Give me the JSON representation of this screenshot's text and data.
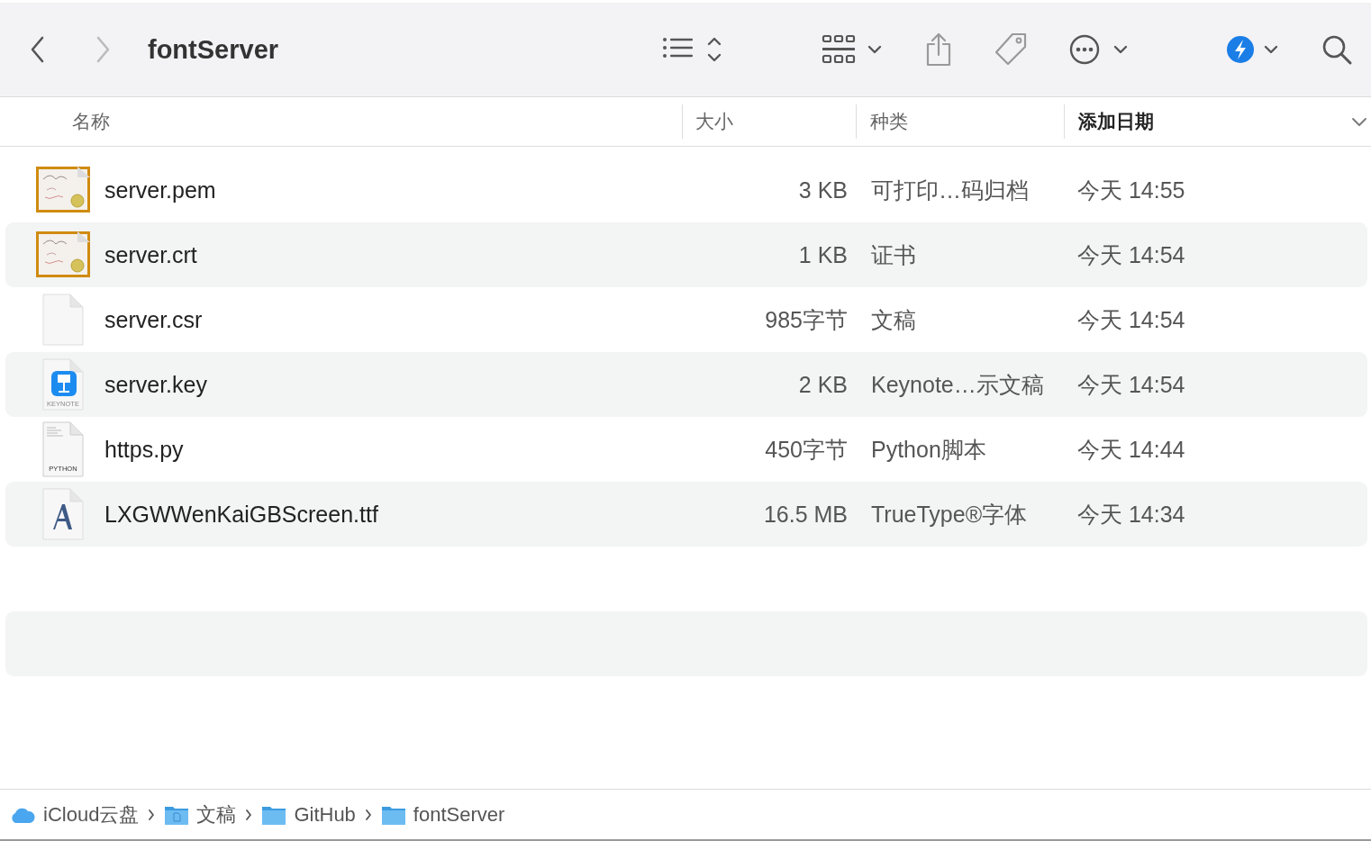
{
  "toolbar": {
    "title": "fontServer",
    "back_enabled": true,
    "forward_enabled": false
  },
  "columns": [
    {
      "label": "名称",
      "sorted": false
    },
    {
      "label": "大小",
      "sorted": false
    },
    {
      "label": "种类",
      "sorted": false
    },
    {
      "label": "添加日期",
      "sorted": true
    }
  ],
  "files": [
    {
      "name": "server.pem",
      "size": "3 KB",
      "kind_label": "可打印…码归档",
      "date": "今天 14:55",
      "kind": "certificate"
    },
    {
      "name": "server.crt",
      "size": "1 KB",
      "kind_label": "证书",
      "date": "今天 14:54",
      "kind": "certificate"
    },
    {
      "name": "server.csr",
      "size": "985字节",
      "kind_label": "文稿",
      "date": "今天 14:54",
      "kind": "blank"
    },
    {
      "name": "server.key",
      "size": "2 KB",
      "kind_label": "Keynote…示文稿",
      "date": "今天 14:54",
      "kind": "keynote",
      "badge": "KEYNOTE"
    },
    {
      "name": "https.py",
      "size": "450字节",
      "kind_label": "Python脚本",
      "date": "今天 14:44",
      "kind": "python",
      "badge": "PYTHON"
    },
    {
      "name": "LXGWWenKaiGBScreen.ttf",
      "size": "16.5 MB",
      "kind_label": "TrueType®字体",
      "date": "今天 14:34",
      "kind": "font"
    }
  ],
  "path_bar": [
    {
      "label": "iCloud云盘",
      "kind": "cloud"
    },
    {
      "label": "文稿",
      "kind": "doc-folder"
    },
    {
      "label": "GitHub",
      "kind": "folder"
    },
    {
      "label": "fontServer",
      "kind": "folder"
    }
  ]
}
